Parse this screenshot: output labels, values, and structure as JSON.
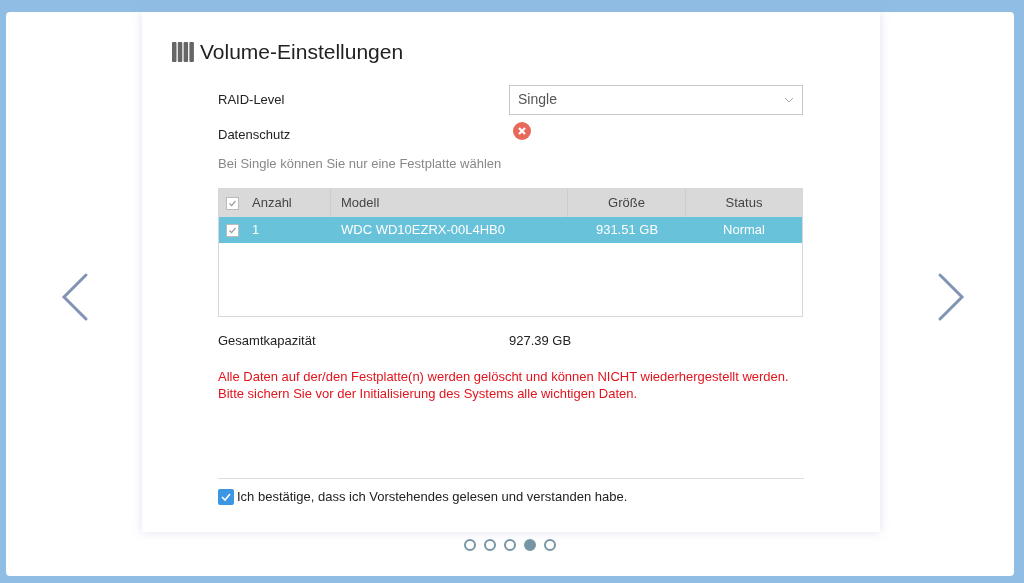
{
  "title": "Volume-Einstellungen",
  "fields": [
    {
      "label": "RAID-Level",
      "kind": "select",
      "value": "Single"
    },
    {
      "label": "Datenschutz",
      "kind": "status",
      "ok": false
    }
  ],
  "hint": "Bei Single können Sie nur eine Festplatte wählen",
  "table": {
    "header_checked": true,
    "columns": [
      "Anzahl",
      "Modell",
      "Größe",
      "Status"
    ],
    "rows": [
      {
        "checked": true,
        "selected": true,
        "cells": [
          "1",
          "WDC WD10EZRX-00L4HB0",
          "931.51 GB",
          "Normal"
        ]
      }
    ]
  },
  "capacity": {
    "label": "Gesamtkapazität",
    "value": "927.39 GB"
  },
  "warning": [
    "Alle Daten auf der/den Festplatte(n) werden gelöscht und können NICHT wiederhergestellt werden.",
    "Bitte sichern Sie vor der Initialisierung des Systems alle wichtigen Daten."
  ],
  "confirm": {
    "label": "Ich bestätige, dass ich Vorstehendes gelesen und verstanden habe.",
    "checked": true
  },
  "pages": [
    {
      "selected": false
    },
    {
      "selected": false
    },
    {
      "selected": false
    },
    {
      "selected": true
    },
    {
      "selected": false
    }
  ]
}
